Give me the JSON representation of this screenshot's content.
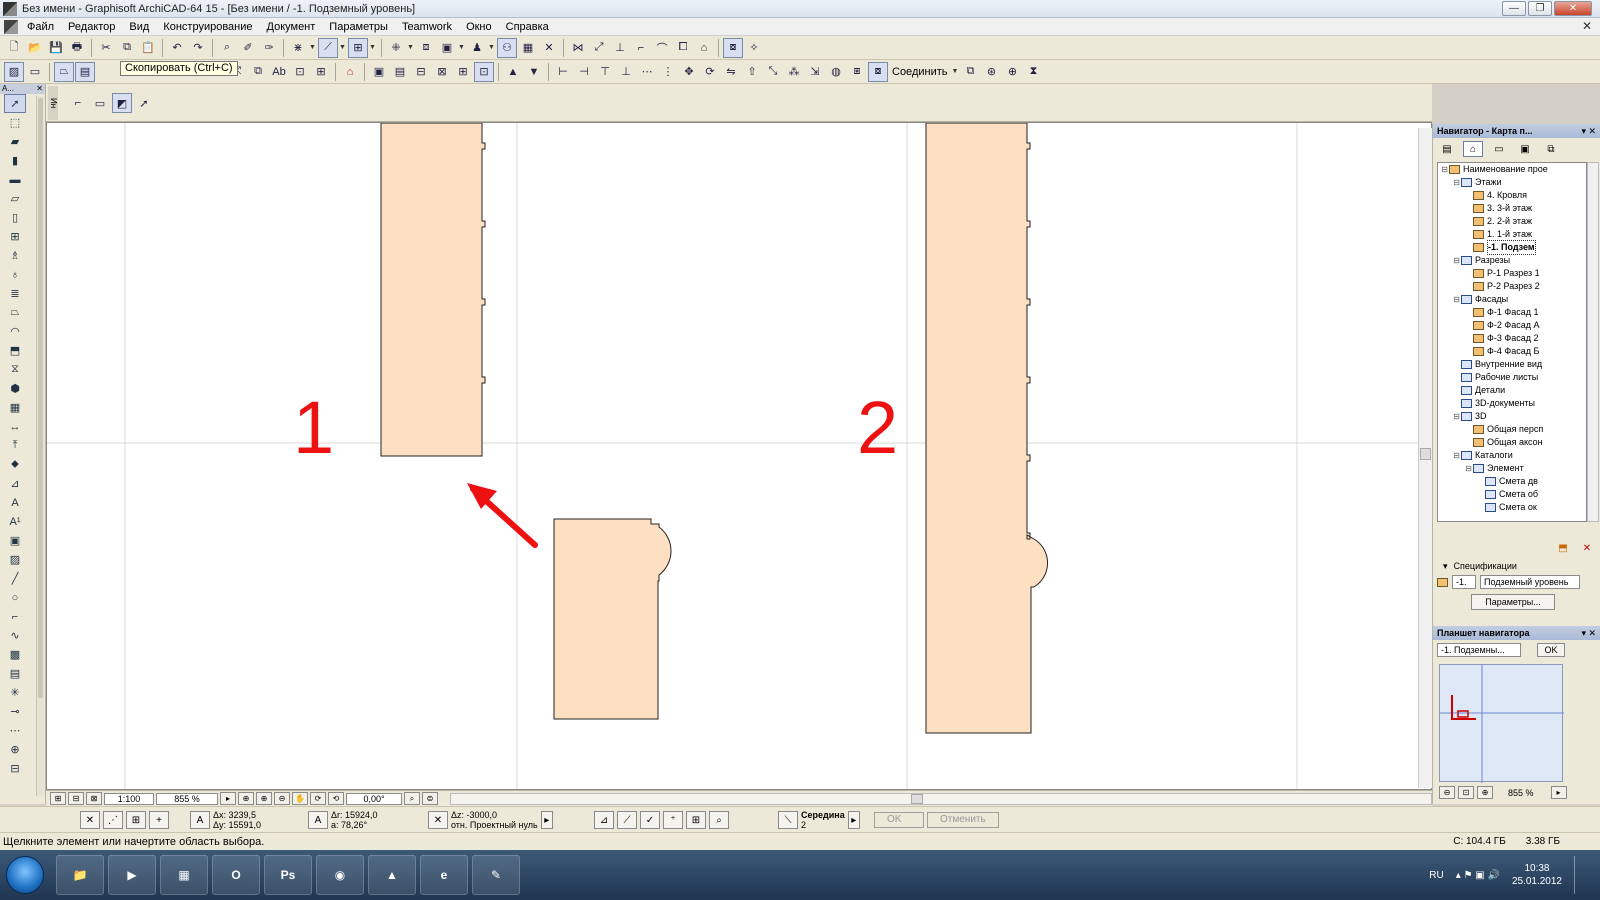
{
  "window": {
    "title": "Без имени - Graphisoft ArchiCAD-64 15 - [Без имени / -1. Подземный уровень]",
    "minimize_label": "—",
    "maximize_label": "❐",
    "close_label": "✕"
  },
  "menu": {
    "items": [
      "Файл",
      "Редактор",
      "Вид",
      "Конструирование",
      "Документ",
      "Параметры",
      "Teamwork",
      "Окно",
      "Справка"
    ],
    "close_doc_label": "✕"
  },
  "toolbar": {
    "tooltip": "Скопировать (Ctrl+C)",
    "connect_label": "Соединить"
  },
  "toolbox": {
    "title": "А...",
    "close_label": "✕"
  },
  "infobox": {
    "grip_label": "Ин"
  },
  "canvas": {
    "label_1": "1",
    "label_2": "2",
    "fill_color": "#fde0c2",
    "stroke_color": "#222222",
    "arrow_color": "#ee1111",
    "grid_color": "#d8d8d8"
  },
  "canvasbar": {
    "scale": "1:100",
    "zoom": "855 %",
    "angle": "0,00°"
  },
  "coords": {
    "dx": "Δx: 3239,5",
    "dy": "Δy: 15591,0",
    "dr": "Δr: 15924,0",
    "a": "a: 78,26°",
    "dz": "Δz: -3000,0",
    "dz_ref": "отн. Проектный нуль",
    "snap_label": "Середина",
    "snap_value": "2",
    "ok_label": "OK",
    "cancel_label": "Отменить"
  },
  "status": {
    "message": "Щелкните элемент или начертите область выбора.",
    "disk_c": "C: 104.4 ГБ",
    "memory": "3.38 ГБ"
  },
  "navigator": {
    "title": "Навигатор - Карта п...",
    "tree": [
      {
        "label": "Наименование прое",
        "level": 0,
        "expander": "⊟",
        "icon": "house"
      },
      {
        "label": "Этажи",
        "level": 1,
        "expander": "⊟",
        "icon": "blue"
      },
      {
        "label": "4. Кровля",
        "level": 2,
        "expander": "",
        "icon": "house"
      },
      {
        "label": "3. 3-й этаж",
        "level": 2,
        "expander": "",
        "icon": "house"
      },
      {
        "label": "2. 2-й этаж",
        "level": 2,
        "expander": "",
        "icon": "house"
      },
      {
        "label": "1. 1-й этаж",
        "level": 2,
        "expander": "",
        "icon": "house"
      },
      {
        "label": "-1. Подзем",
        "level": 2,
        "expander": "",
        "icon": "house",
        "selected": true
      },
      {
        "label": "Разрезы",
        "level": 1,
        "expander": "⊟",
        "icon": "blue"
      },
      {
        "label": "Р-1 Разрез 1",
        "level": 2,
        "expander": "",
        "icon": "house"
      },
      {
        "label": "Р-2 Разрез 2",
        "level": 2,
        "expander": "",
        "icon": "house"
      },
      {
        "label": "Фасады",
        "level": 1,
        "expander": "⊟",
        "icon": "blue"
      },
      {
        "label": "Ф-1 Фасад 1",
        "level": 2,
        "expander": "",
        "icon": "house"
      },
      {
        "label": "Ф-2 Фасад А",
        "level": 2,
        "expander": "",
        "icon": "house"
      },
      {
        "label": "Ф-3 Фасад 2",
        "level": 2,
        "expander": "",
        "icon": "house"
      },
      {
        "label": "Ф-4 Фасад Б",
        "level": 2,
        "expander": "",
        "icon": "house"
      },
      {
        "label": "Внутренние вид",
        "level": 1,
        "expander": "",
        "icon": "blue"
      },
      {
        "label": "Рабочие листы",
        "level": 1,
        "expander": "",
        "icon": "blue"
      },
      {
        "label": "Детали",
        "level": 1,
        "expander": "",
        "icon": "blue"
      },
      {
        "label": "3D-документы",
        "level": 1,
        "expander": "",
        "icon": "blue"
      },
      {
        "label": "3D",
        "level": 1,
        "expander": "⊟",
        "icon": "blue"
      },
      {
        "label": "Общая персп",
        "level": 2,
        "expander": "",
        "icon": "house"
      },
      {
        "label": "Общая аксон",
        "level": 2,
        "expander": "",
        "icon": "house"
      },
      {
        "label": "Каталоги",
        "level": 1,
        "expander": "⊟",
        "icon": "blue"
      },
      {
        "label": "Элемент",
        "level": 2,
        "expander": "⊟",
        "icon": "blue"
      },
      {
        "label": "Смета дв",
        "level": 3,
        "expander": "",
        "icon": "blue"
      },
      {
        "label": "Смета об",
        "level": 3,
        "expander": "",
        "icon": "blue"
      },
      {
        "label": "Смета ок",
        "level": 3,
        "expander": "",
        "icon": "blue"
      }
    ],
    "spec_label": "Спецификации",
    "level_num": "-1.",
    "level_name": "Подземный уровень",
    "params_button": "Параметры..."
  },
  "navpad": {
    "title": "Планшет навигатора",
    "view_name": "-1. Подземны...",
    "ok_label": "OK",
    "zoom": "855 %"
  },
  "taskbar": {
    "apps": [
      {
        "name": "explorer",
        "glyph": "📁"
      },
      {
        "name": "media",
        "glyph": "▶"
      },
      {
        "name": "calculator",
        "glyph": "▦"
      },
      {
        "name": "opera",
        "glyph": "O"
      },
      {
        "name": "photoshop",
        "glyph": "Ps"
      },
      {
        "name": "chrome",
        "glyph": "◉"
      },
      {
        "name": "archicad",
        "glyph": "▲"
      },
      {
        "name": "ie",
        "glyph": "e"
      },
      {
        "name": "paint",
        "glyph": "✎"
      }
    ],
    "lang": "RU",
    "time": "10:38",
    "date": "25.01.2012"
  }
}
